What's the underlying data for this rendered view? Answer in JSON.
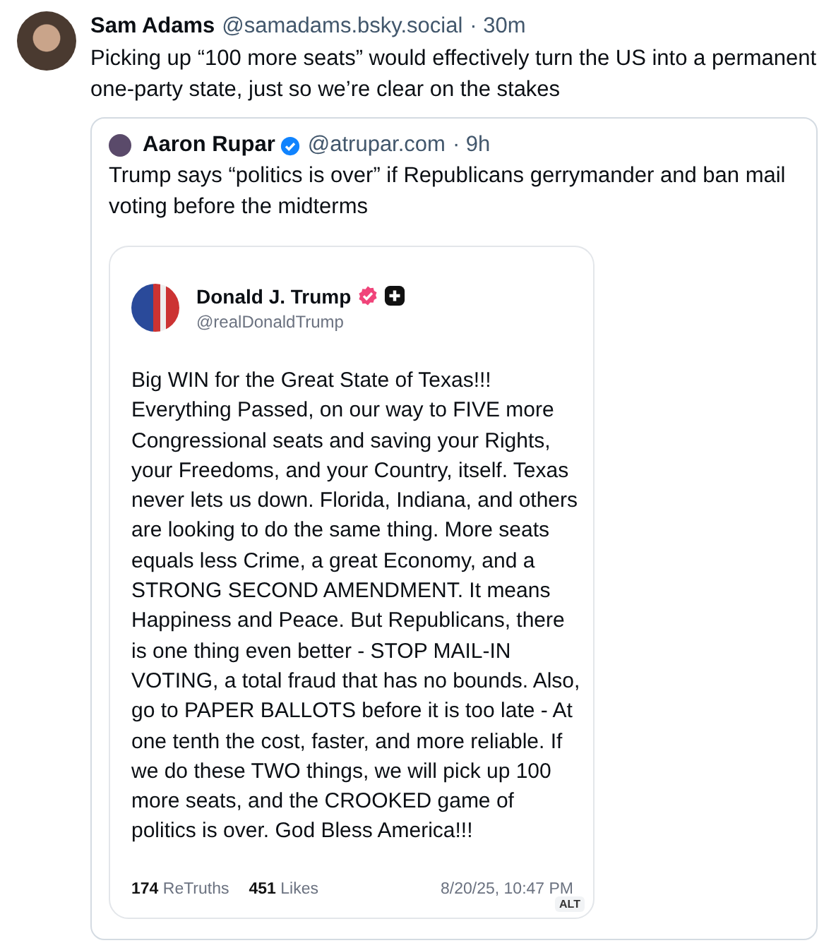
{
  "post": {
    "author": "Sam Adams",
    "handle": "@samadams.bsky.social",
    "time": "· 30m",
    "text": "Picking up “100 more seats” would effectively turn the US into a permanent one-party state, just so we’re clear on the stakes"
  },
  "quote": {
    "author": "Aaron Rupar",
    "verified": true,
    "handle": "@atrupar.com",
    "time": "· 9h",
    "text": "Trump says “politics is over” if Republicans gerrymander and ban mail voting before the midterms"
  },
  "embed": {
    "author": "Donald J. Trump",
    "verified": true,
    "handle": "@realDonaldTrump",
    "text": "Big WIN for the Great State of Texas!!! Everything Passed, on our way to FIVE more Congressional seats and saving your Rights, your Freedoms, and your Country, itself. Texas never lets us down. Florida, Indiana, and others are looking to do the same thing. More seats equals less Crime, a great Economy, and a STRONG SECOND AMENDMENT. It means Happiness and Peace. But Republicans, there is one thing even better - STOP MAIL-IN VOTING, a total fraud that has no bounds. Also, go to PAPER BALLOTS before it is too late - At one tenth the cost, faster, and more reliable. If we do these TWO things, we will pick up 100 more seats, and the CROOKED game of politics is over. God Bless America!!!",
    "stats": [
      {
        "count": "174",
        "label": "ReTruths"
      },
      {
        "count": "451",
        "label": "Likes"
      }
    ],
    "date": "8/20/25, 10:47 PM",
    "alt": "ALT"
  }
}
